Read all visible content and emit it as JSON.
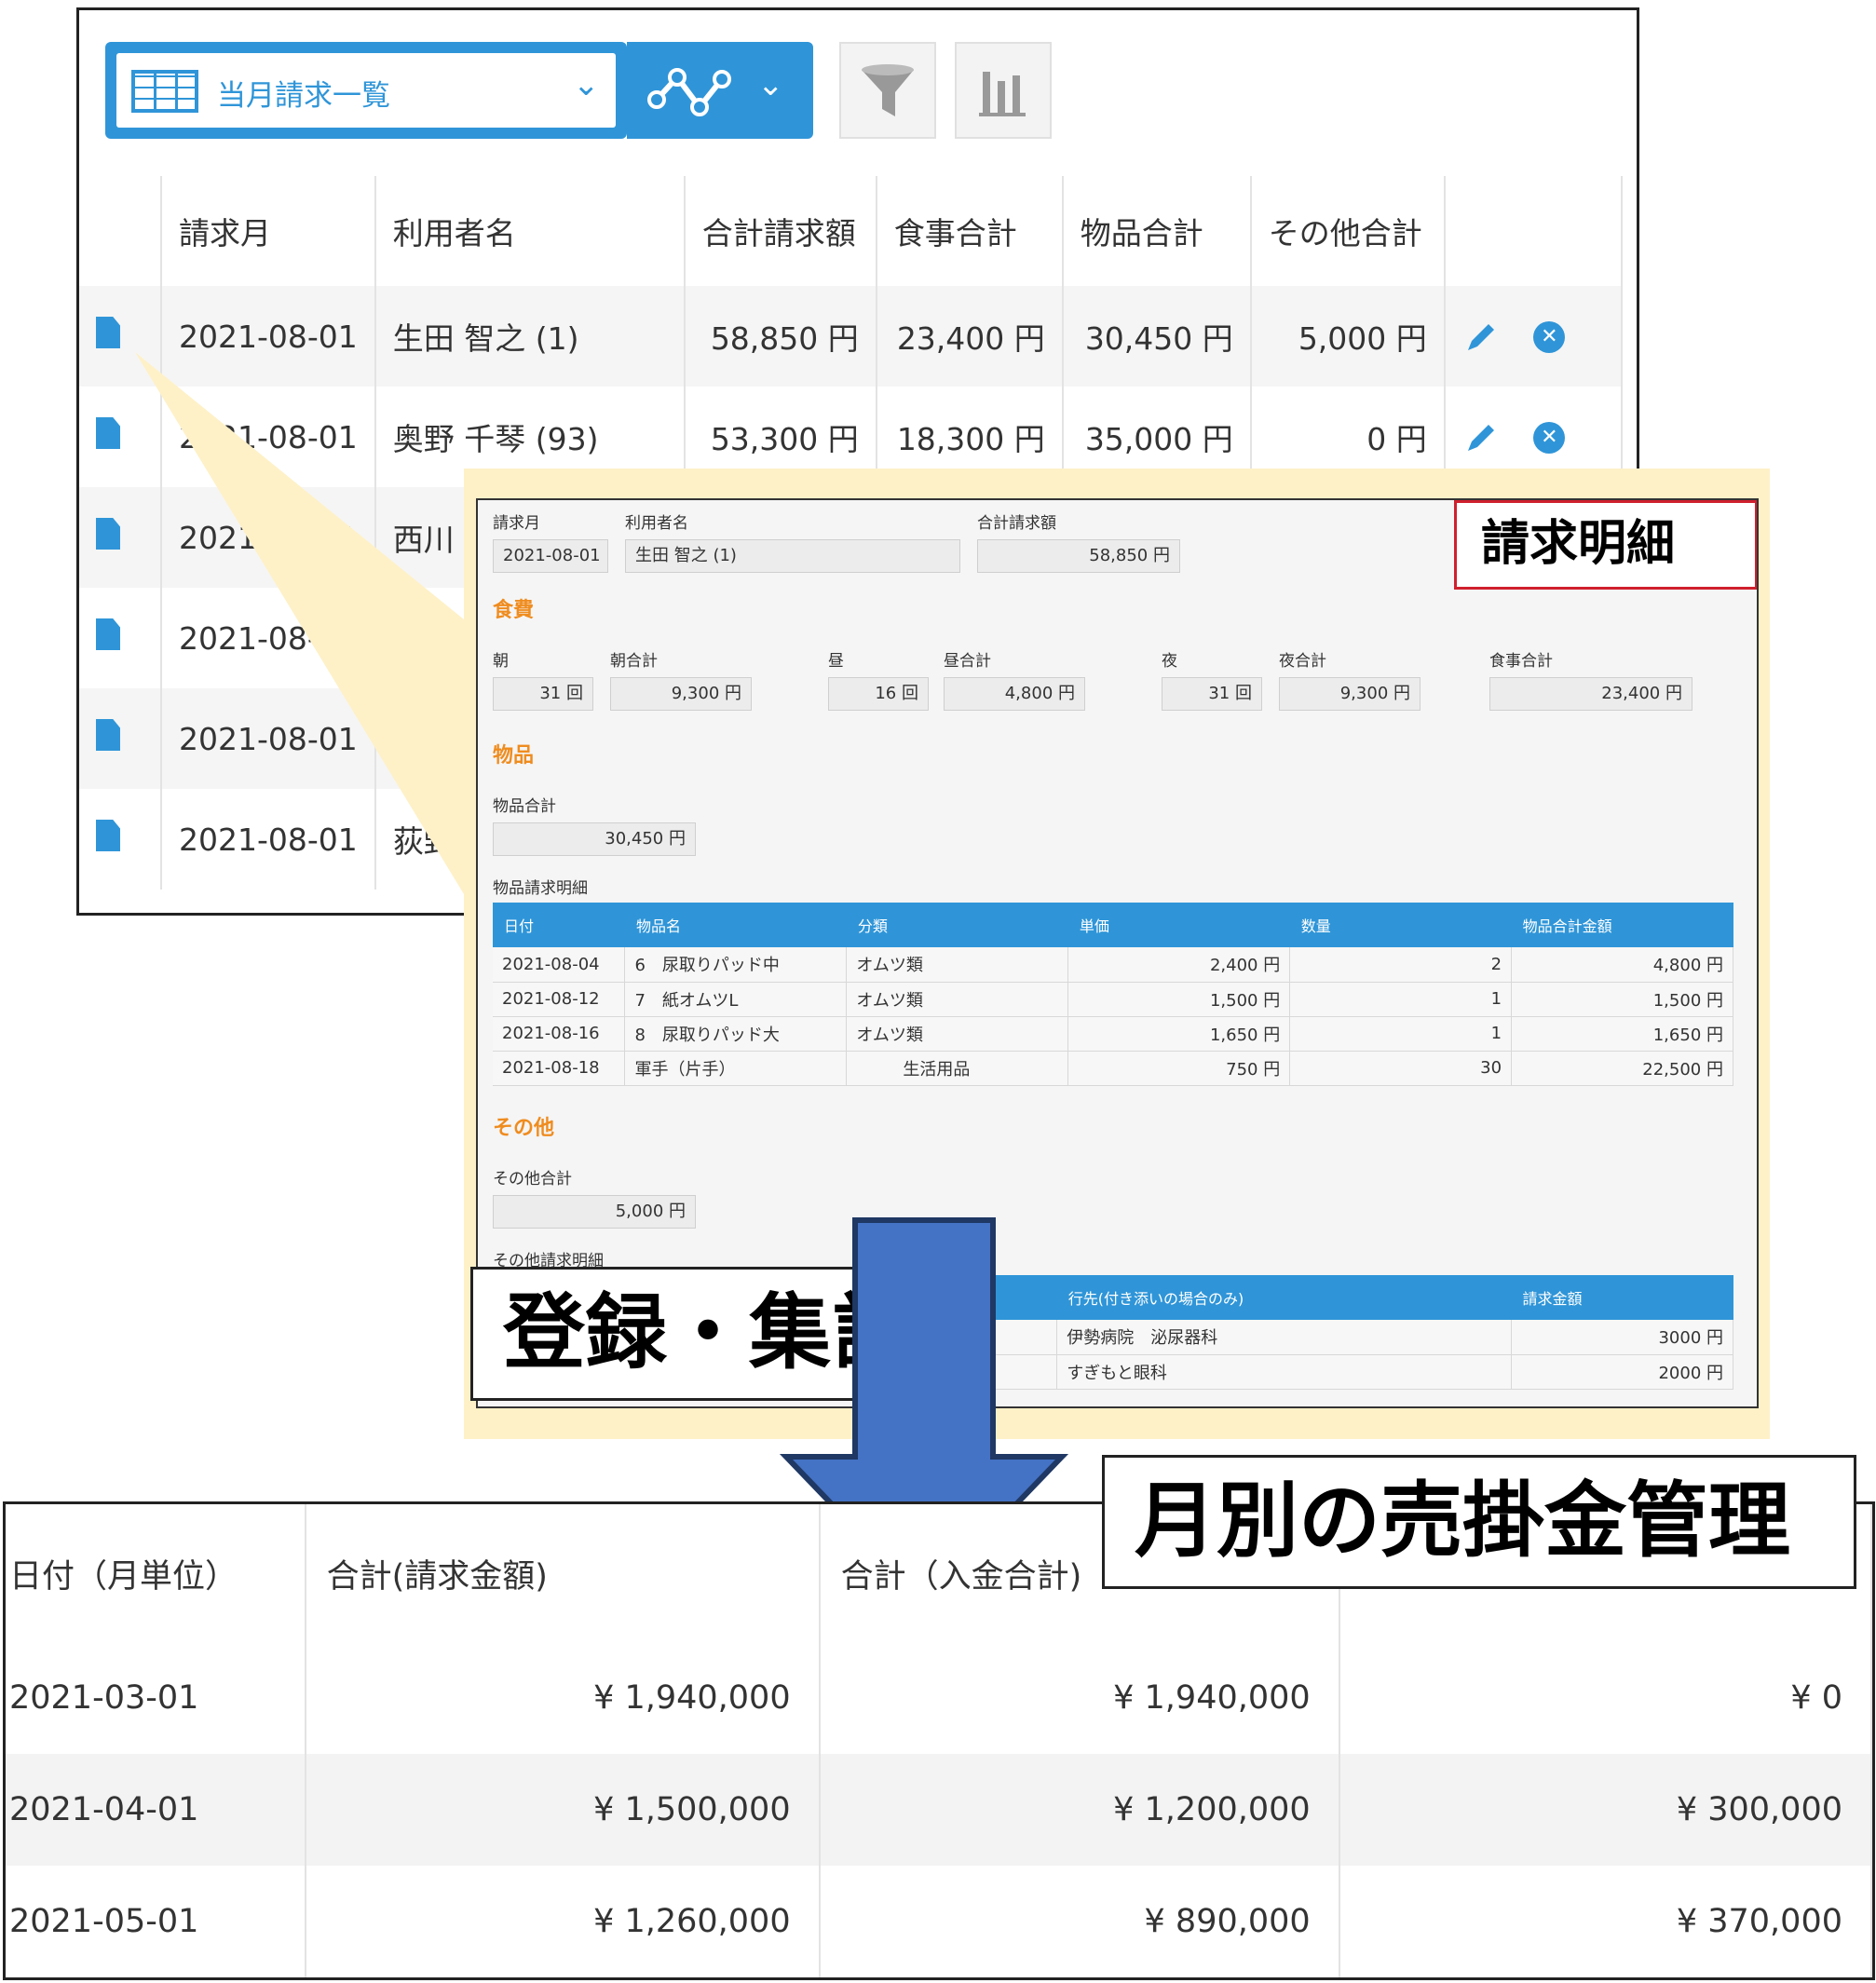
{
  "list_view": {
    "view_name": "当月請求一覧",
    "columns": [
      "請求月",
      "利用者名",
      "合計請求額",
      "食事合計",
      "物品合計",
      "その他合計"
    ],
    "rows": [
      {
        "month": "2021-08-01",
        "name": "生田 智之 (1)",
        "total": "58,850 円",
        "meal": "23,400 円",
        "goods": "30,450 円",
        "other": "5,000 円"
      },
      {
        "month": "2021-08-01",
        "name": "奥野 千琴 (93)",
        "total": "53,300 円",
        "meal": "18,300 円",
        "goods": "35,000 円",
        "other": "0 円"
      },
      {
        "month": "2021-08-01",
        "name": "西川",
        "total": "",
        "meal": "",
        "goods": "",
        "other": ""
      },
      {
        "month": "2021-08-01",
        "name": "",
        "total": "",
        "meal": "",
        "goods": "",
        "other": ""
      },
      {
        "month": "2021-08-01",
        "name": "",
        "total": "",
        "meal": "",
        "goods": "",
        "other": ""
      },
      {
        "month": "2021-08-01",
        "name": "荻野",
        "total": "",
        "meal": "",
        "goods": "",
        "other": ""
      }
    ]
  },
  "detail": {
    "title": "請求明細",
    "header": {
      "month_label": "請求月",
      "month_value": "2021-08-01",
      "name_label": "利用者名",
      "name_value": "生田 智之 (1)",
      "total_label": "合計請求額",
      "total_value": "58,850 円"
    },
    "meal": {
      "section": "食費",
      "morning_label": "朝",
      "morning_value": "31 回",
      "morning_total_label": "朝合計",
      "morning_total_value": "9,300 円",
      "noon_label": "昼",
      "noon_value": "16 回",
      "noon_total_label": "昼合計",
      "noon_total_value": "4,800 円",
      "night_label": "夜",
      "night_value": "31 回",
      "night_total_label": "夜合計",
      "night_total_value": "9,300 円",
      "meal_total_label": "食事合計",
      "meal_total_value": "23,400 円"
    },
    "goods": {
      "section": "物品",
      "total_label": "物品合計",
      "total_value": "30,450 円",
      "table_label": "物品請求明細",
      "columns": [
        "日付",
        "物品名",
        "分類",
        "単価",
        "数量",
        "物品合計金額"
      ],
      "rows": [
        {
          "date": "2021-08-04",
          "item": "6　尿取りパッド中",
          "category": "オムツ類",
          "unit": "2,400 円",
          "qty": "2",
          "amount": "4,800 円"
        },
        {
          "date": "2021-08-12",
          "item": "7　紙オムツL",
          "category": "オムツ類",
          "unit": "1,500 円",
          "qty": "1",
          "amount": "1,500 円"
        },
        {
          "date": "2021-08-16",
          "item": "8　尿取りパッド大",
          "category": "オムツ類",
          "unit": "1,650 円",
          "qty": "1",
          "amount": "1,650 円"
        },
        {
          "date": "2021-08-18",
          "item": "軍手（片手）",
          "category": "生活用品",
          "unit": "750 円",
          "qty": "30",
          "amount": "22,500 円"
        }
      ]
    },
    "other": {
      "section": "その他",
      "total_label": "その他合計",
      "total_value": "5,000 円",
      "table_label": "その他請求明細",
      "columns": [
        "行先(付き添いの場合のみ)",
        "請求金額"
      ],
      "rows": [
        {
          "dest": "伊勢病院　泌尿器科",
          "amount": "3000 円"
        },
        {
          "dest": "すぎもと眼科",
          "amount": "2000 円"
        }
      ]
    }
  },
  "labels": {
    "register": "登録・集計",
    "monthly": "月別の売掛金管理"
  },
  "summary": {
    "columns": [
      "日付（月単位）",
      "合計(請求金額)",
      "合計（入金合計)",
      ""
    ],
    "rows": [
      {
        "month": "2021-03-01",
        "billed": "¥ 1,940,000",
        "paid": "¥ 1,940,000",
        "balance": "¥ 0"
      },
      {
        "month": "2021-04-01",
        "billed": "¥ 1,500,000",
        "paid": "¥ 1,200,000",
        "balance": "¥ 300,000"
      },
      {
        "month": "2021-05-01",
        "billed": "¥ 1,260,000",
        "paid": "¥ 890,000",
        "balance": "¥ 370,000"
      }
    ]
  },
  "colors": {
    "accent": "#2f95d8",
    "section": "#ef8c1f",
    "callout": "#fef1c8",
    "arrow": "#4472c4",
    "title_border": "#d0202e"
  },
  "icons": [
    "table-icon",
    "line-chart-icon",
    "chevron-down-icon",
    "filter-icon",
    "bar-chart-icon",
    "document-icon",
    "pencil-icon",
    "close-circle-icon",
    "down-arrow-icon"
  ]
}
